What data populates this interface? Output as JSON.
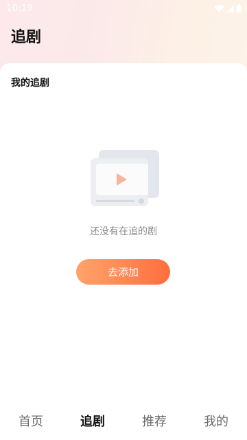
{
  "status_bar": {
    "time": "10:19",
    "icons": [
      "wifi-icon",
      "signal-icon",
      "battery-icon"
    ]
  },
  "header": {
    "title": "追剧"
  },
  "section": {
    "title": "我的追剧"
  },
  "empty_state": {
    "illustration": "video-placeholder-icon",
    "message": "还没有在追的剧",
    "button_label": "去添加"
  },
  "tabs": [
    {
      "label": "首页",
      "active": false
    },
    {
      "label": "追剧",
      "active": true
    },
    {
      "label": "推荐",
      "active": false
    },
    {
      "label": "我的",
      "active": false
    }
  ],
  "colors": {
    "accent_start": "#ffa36b",
    "accent_end": "#ff6e3e",
    "play_icon": "#f7b59a"
  }
}
